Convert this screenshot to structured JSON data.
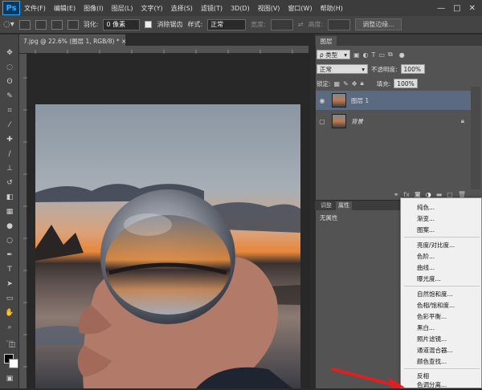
{
  "menubar": {
    "logo": "Ps",
    "items": [
      "文件(F)",
      "编辑(E)",
      "图像(I)",
      "图层(L)",
      "文字(Y)",
      "选择(S)",
      "滤镜(T)",
      "3D(D)",
      "视图(V)",
      "窗口(W)",
      "帮助(H)"
    ],
    "win_controls": [
      "—",
      "□",
      "✕"
    ]
  },
  "options": {
    "feather_label": "羽化:",
    "feather_value": "0 像素",
    "antialias_label": "消除锯齿",
    "style_label": "样式:",
    "style_value": "正常",
    "width_label": "宽度:",
    "height_label": "高度:",
    "refine_button": "调整边缘..."
  },
  "document": {
    "tab_title": "7.jpg @ 22.6% (图层 1, RGB/8) * ×"
  },
  "layers_panel": {
    "tab_label": "图层",
    "kind_filter": "ρ 类型",
    "blend_mode": "正常",
    "opacity_label": "不透明度:",
    "opacity_value": "100%",
    "lock_label": "锁定:",
    "fill_label": "填充:",
    "fill_value": "100%",
    "layers": [
      {
        "name": "图层 1",
        "selected": true,
        "visible": true
      },
      {
        "name": "背景",
        "selected": false,
        "visible": false,
        "locked": true
      }
    ]
  },
  "properties_panel": {
    "tabs": [
      "调整",
      "属性"
    ],
    "text": "无属性"
  },
  "adjustment_menu": {
    "groups": [
      [
        "纯色...",
        "渐变...",
        "图案..."
      ],
      [
        "亮度/对比度...",
        "色阶...",
        "曲线...",
        "曝光度..."
      ],
      [
        "自然饱和度...",
        "色相/饱和度...",
        "色彩平衡...",
        "黑白...",
        "照片滤镜...",
        "通道混合器...",
        "颜色查找..."
      ],
      [
        "反相",
        "色调分离..."
      ]
    ]
  },
  "colors": {
    "accent": "#31a8ff",
    "annotation_arrow": "#e02020",
    "selected_layer": "#5a6a80"
  }
}
